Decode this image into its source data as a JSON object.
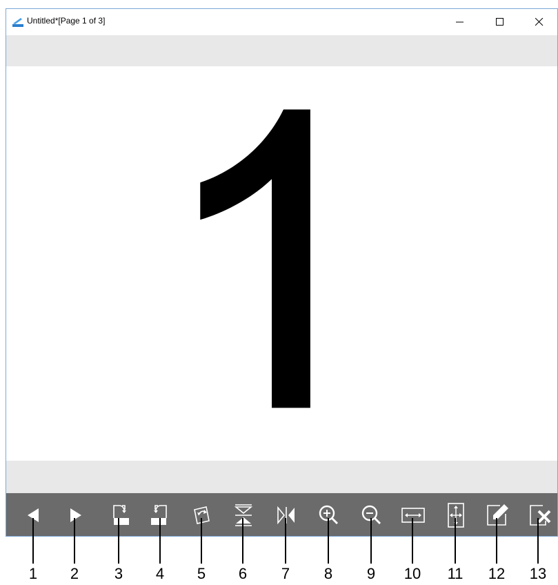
{
  "window": {
    "title": "Untitled*[Page 1 of 3]",
    "controls": [
      "minimize-icon",
      "maximize-icon",
      "close-icon"
    ]
  },
  "page": {
    "content": "1",
    "current_page": 1,
    "total_pages": 3
  },
  "toolbar": {
    "items": [
      {
        "icon": "previous-page-icon",
        "callout": "1"
      },
      {
        "icon": "next-page-icon",
        "callout": "2"
      },
      {
        "icon": "rotate-right-icon",
        "callout": "3"
      },
      {
        "icon": "rotate-left-icon",
        "callout": "4"
      },
      {
        "icon": "rotate-180-icon",
        "callout": "5"
      },
      {
        "icon": "flip-vertical-icon",
        "callout": "6"
      },
      {
        "icon": "flip-horizontal-icon",
        "callout": "7"
      },
      {
        "icon": "zoom-in-icon",
        "callout": "8"
      },
      {
        "icon": "zoom-out-icon",
        "callout": "9"
      },
      {
        "icon": "fit-width-icon",
        "callout": "10"
      },
      {
        "icon": "fit-page-icon",
        "callout": "11"
      },
      {
        "icon": "edit-icon",
        "callout": "12"
      },
      {
        "icon": "delete-page-icon",
        "callout": "13"
      }
    ]
  },
  "colors": {
    "toolbar_bg": "#6b6b6b",
    "icon": "#ffffff",
    "gray_band": "#e8e8e8",
    "window_border": "#7aa7d8"
  }
}
